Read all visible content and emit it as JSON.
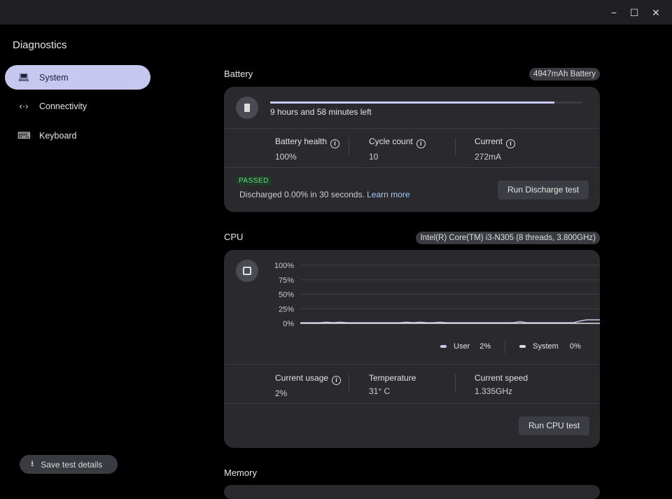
{
  "window": {
    "minimize": "−",
    "maximize": "☐",
    "close": "✕"
  },
  "app_title": "Diagnostics",
  "sidebar": {
    "items": [
      {
        "label": "System",
        "icon": "laptop-icon"
      },
      {
        "label": "Connectivity",
        "icon": "connectivity-icon"
      },
      {
        "label": "Keyboard",
        "icon": "keyboard-icon"
      }
    ],
    "save_label": "Save test details"
  },
  "battery": {
    "title": "Battery",
    "chip": "4947mAh Battery",
    "charge_fraction": 0.91,
    "time_left": "9 hours and 58 minutes left",
    "stats": [
      {
        "label": "Battery health",
        "value": "100%"
      },
      {
        "label": "Cycle count",
        "value": "10"
      },
      {
        "label": "Current",
        "value": "272mA"
      }
    ],
    "status": "PASSED",
    "result": "Discharged 0.00% in 30 seconds.",
    "learn_more": "Learn more",
    "run_label": "Run Discharge test"
  },
  "cpu": {
    "title": "CPU",
    "chip": "Intel(R) Core(TM) i3-N305 (8 threads, 3.800GHz)",
    "chart_data": {
      "type": "line",
      "y_ticks": [
        "100%",
        "75%",
        "50%",
        "25%",
        "0%"
      ],
      "ylim": [
        0,
        100
      ],
      "series": [
        {
          "name": "User",
          "values": [
            1,
            1,
            1,
            1,
            2,
            1,
            2,
            1,
            1,
            1,
            1,
            1,
            1,
            1,
            1,
            1,
            2,
            1,
            2,
            1,
            1,
            2,
            1,
            1,
            1,
            1,
            1,
            1,
            1,
            1,
            1,
            1,
            1,
            3,
            1,
            1,
            1,
            1,
            1,
            1,
            1,
            1,
            4,
            6,
            6,
            6
          ]
        },
        {
          "name": "System",
          "values": [
            0,
            0,
            0,
            0,
            0,
            0,
            0,
            0,
            0,
            0,
            0,
            0,
            0,
            0,
            0,
            0,
            0,
            0,
            0,
            0,
            0,
            0,
            0,
            0,
            0,
            0,
            0,
            0,
            0,
            0,
            0,
            0,
            0,
            0,
            0,
            0,
            0,
            0,
            0,
            0,
            0,
            0,
            0,
            0,
            0,
            0
          ]
        }
      ]
    },
    "legend": [
      {
        "name": "User",
        "value": "2%"
      },
      {
        "name": "System",
        "value": "0%"
      }
    ],
    "stats": [
      {
        "label": "Current usage",
        "value": "2%"
      },
      {
        "label": "Temperature",
        "value": "31° C"
      },
      {
        "label": "Current speed",
        "value": "1.335GHz"
      }
    ],
    "run_label": "Run CPU test"
  },
  "memory": {
    "title": "Memory"
  },
  "colors": {
    "accent": "#c7c8ef",
    "passed": "#6dd58c"
  }
}
